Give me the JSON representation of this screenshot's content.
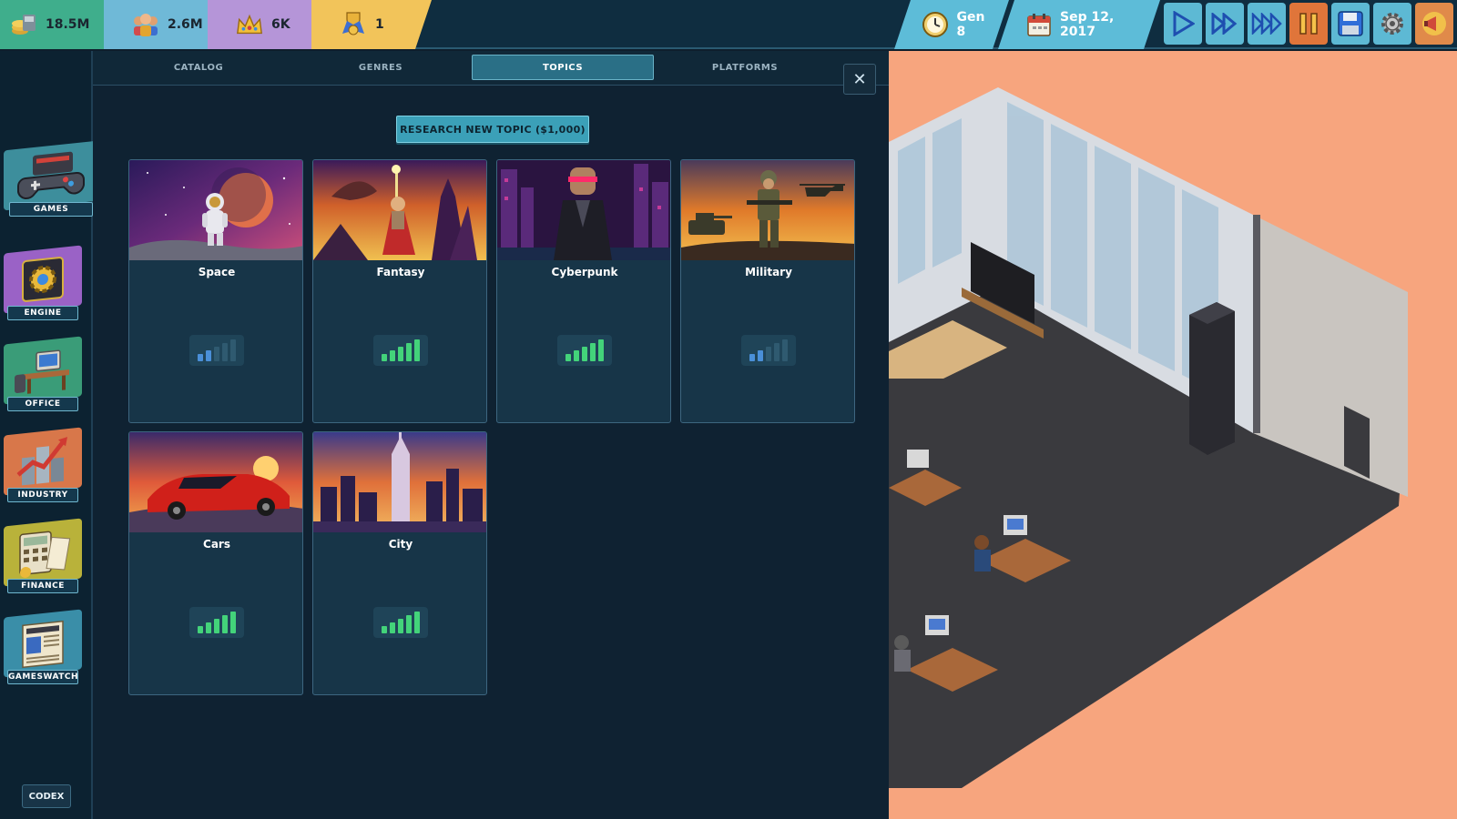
{
  "topbar": {
    "money": "18.5M",
    "fans": "2.6M",
    "hype": "6K",
    "awards": "1",
    "generation": "Gen 8",
    "date": "Sep 12, 2017",
    "controls": [
      "play",
      "fast-forward",
      "fastest",
      "pause",
      "save",
      "settings",
      "notifications"
    ]
  },
  "sidebar": {
    "items": [
      {
        "label": "GAMES"
      },
      {
        "label": "ENGINE"
      },
      {
        "label": "OFFICE"
      },
      {
        "label": "INDUSTRY"
      },
      {
        "label": "FINANCE"
      },
      {
        "label": "GAMESWATCH"
      }
    ],
    "codex_label": "CODEX"
  },
  "panel": {
    "tabs": [
      {
        "label": "CATALOG"
      },
      {
        "label": "GENRES"
      },
      {
        "label": "TOPICS"
      },
      {
        "label": "PLATFORMS"
      }
    ],
    "active_tab": "TOPICS",
    "close_symbol": "✕",
    "research_button": "RESEARCH NEW TOPIC ($1,000)",
    "topics": [
      {
        "name": "Space",
        "signal_level": 2
      },
      {
        "name": "Fantasy",
        "signal_level": 5
      },
      {
        "name": "Cyberpunk",
        "signal_level": 5
      },
      {
        "name": "Military",
        "signal_level": 2
      },
      {
        "name": "Cars",
        "signal_level": 5
      },
      {
        "name": "City",
        "signal_level": 5
      }
    ]
  },
  "colors": {
    "money_bg": "#3fae8c",
    "fans_bg": "#6fb9d7",
    "hype_bg": "#b595d8",
    "awards_bg": "#f2c45a",
    "time_bg": "#5dbcd8",
    "signal_high": "#43d37a",
    "signal_low": "#4a8fd8",
    "signal_off": "#2f5a70"
  }
}
